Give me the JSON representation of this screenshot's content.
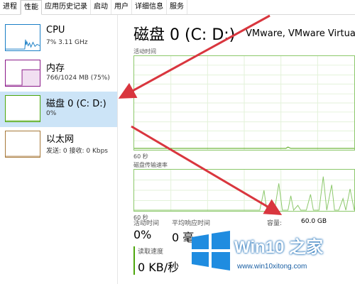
{
  "tabs": [
    {
      "label": "进程"
    },
    {
      "label": "性能"
    },
    {
      "label": "应用历史记录"
    },
    {
      "label": "启动"
    },
    {
      "label": "用户"
    },
    {
      "label": "详细信息"
    },
    {
      "label": "服务"
    }
  ],
  "sidebar": {
    "items": [
      {
        "title": "CPU",
        "subtitle": "7% 3.11 GHz",
        "color": "#1a7fc6"
      },
      {
        "title": "内存",
        "subtitle": "766/1024 MB (75%)",
        "color": "#8b1a89"
      },
      {
        "title": "磁盘 0 (C: D:)",
        "subtitle": "0%",
        "color": "#4da60c"
      },
      {
        "title": "以太网",
        "subtitle": "发送: 0 接收: 0 Kbps",
        "color": "#a7793a"
      }
    ]
  },
  "main": {
    "title": "磁盘 0 (C: D:)",
    "model": "VMware, VMware Virtual",
    "graph1": {
      "label": "活动时间",
      "footer": "60 秒"
    },
    "graph2": {
      "label": "磁盘传输速率",
      "footer": "60 秒"
    },
    "stats": {
      "active_time_label": "活动时间",
      "active_time_value": "0%",
      "response_label": "平均响应时间",
      "response_value": "0 毫",
      "read_label": "读取速度",
      "read_value": "0 KB/秒",
      "capacity_label": "容量:",
      "capacity_value": "60.0 GB"
    }
  },
  "watermark": {
    "brand": "Win10 之家",
    "url": "www.win10xitong.com"
  },
  "colors": {
    "disk_accent": "#4da60c",
    "arrow": "#d9363e",
    "selected_bg": "#cce4f7"
  }
}
